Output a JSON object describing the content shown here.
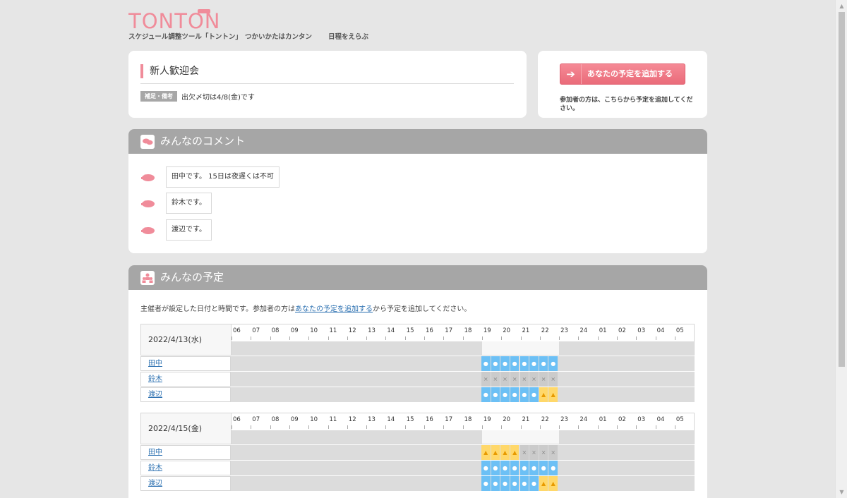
{
  "header": {
    "logo": "TONTON",
    "nav": [
      "スケジュール調整ツール「トントン」",
      "つかいかたはカンタン",
      "日程をえらぶ"
    ]
  },
  "event": {
    "title": "新人歓迎会",
    "note_label": "補足・備考",
    "note_text": "出欠〆切は4/8(金)です"
  },
  "add": {
    "button": "あなたの予定を追加する",
    "note": "参加者の方は、こちらから予定を追加してください。"
  },
  "comments": {
    "title": "みんなのコメント",
    "items": [
      "田中です。 15日は夜遅くは不可",
      "鈴木です。",
      "渡辺です。"
    ]
  },
  "schedule": {
    "title": "みんなの予定",
    "intro_before": "主催者が設定した日付と時間です。参加者の方は",
    "intro_link": "あなたの予定を追加する",
    "intro_after": "から予定を追加してください。",
    "hours": [
      "06",
      "07",
      "08",
      "09",
      "10",
      "11",
      "12",
      "13",
      "14",
      "15",
      "16",
      "17",
      "18",
      "19",
      "20",
      "21",
      "22",
      "23",
      "24",
      "01",
      "02",
      "03",
      "04",
      "05"
    ],
    "open_start_index": 13,
    "open_end_index": 17,
    "days": [
      {
        "date": "2022/4/13(水)",
        "people": [
          {
            "name": "田中",
            "slots": [
              "ok",
              "ok",
              "ok",
              "ok",
              "ok",
              "ok",
              "ok",
              "ok"
            ]
          },
          {
            "name": "鈴木",
            "slots": [
              "ng",
              "ng",
              "ng",
              "ng",
              "ng",
              "ng",
              "ng",
              "ng"
            ]
          },
          {
            "name": "渡辺",
            "slots": [
              "ok",
              "ok",
              "ok",
              "ok",
              "ok",
              "ok",
              "maybe",
              "maybe"
            ]
          }
        ]
      },
      {
        "date": "2022/4/15(金)",
        "people": [
          {
            "name": "田中",
            "slots": [
              "maybe",
              "maybe",
              "maybe",
              "maybe",
              "ng",
              "ng",
              "ng",
              "ng"
            ]
          },
          {
            "name": "鈴木",
            "slots": [
              "ok",
              "ok",
              "ok",
              "ok",
              "ok",
              "ok",
              "ok",
              "ok"
            ]
          },
          {
            "name": "渡辺",
            "slots": [
              "ok",
              "ok",
              "ok",
              "ok",
              "ok",
              "ok",
              "maybe",
              "maybe"
            ]
          }
        ]
      }
    ],
    "colors": {
      "ok": "#6cc0f5",
      "ng": "#cbcbcb",
      "maybe": "#ffd86a"
    },
    "symbols": {
      "ok": "●",
      "ng": "×",
      "maybe": "▲"
    }
  }
}
